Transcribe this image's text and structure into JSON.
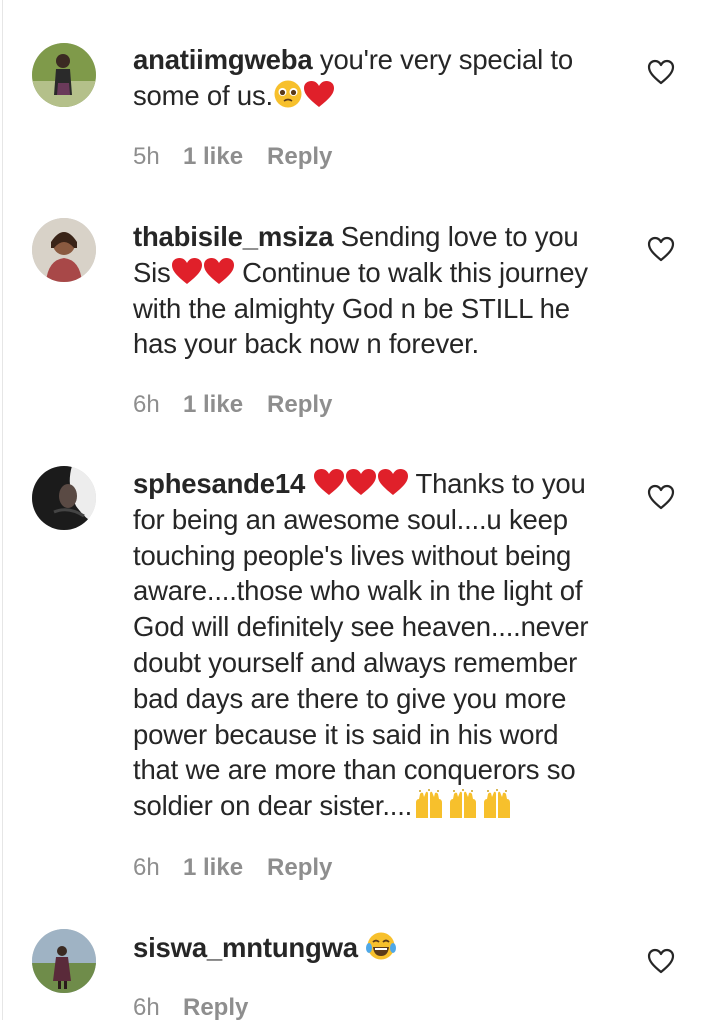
{
  "comments": [
    {
      "username": "anatiimgweba",
      "text_lines": [
        "you're very special to",
        "some of us."
      ],
      "time": "5h",
      "likes": "1 like",
      "reply": "Reply"
    },
    {
      "username": "thabisile_msiza",
      "text_lines": [
        "Sending love to you",
        "Sis",
        "Continue to walk this journey",
        "with the almighty God n be STILL he",
        "has your back now n forever."
      ],
      "time": "6h",
      "likes": "1 like",
      "reply": "Reply"
    },
    {
      "username": "sphesande14",
      "text_lines": [
        "Thanks to you",
        "for being an awesome soul....u keep",
        "touching people's lives without being",
        "aware....those who walk in the light of",
        "God will definitely see heaven....never",
        "doubt yourself and always remember",
        "bad days are there to give you more",
        "power because it is said in his word",
        "that we are more than conquerors so",
        "soldier on dear sister...."
      ],
      "time": "6h",
      "likes": "1 like",
      "reply": "Reply"
    },
    {
      "username": "siswa_mntungwa",
      "text_lines": [],
      "time": "6h",
      "likes": "",
      "reply": "Reply"
    }
  ],
  "icons": {
    "like": "heart-outline-icon",
    "emoji_heart": "red-heart-emoji",
    "emoji_pleading": "pleading-face-emoji",
    "emoji_raised_hands": "raising-hands-emoji",
    "emoji_laughing": "tears-of-joy-emoji"
  },
  "colors": {
    "text": "#262626",
    "meta": "#8e8e8e",
    "heart": "#e0202a",
    "emoji_yellow": "#f7c02c"
  }
}
